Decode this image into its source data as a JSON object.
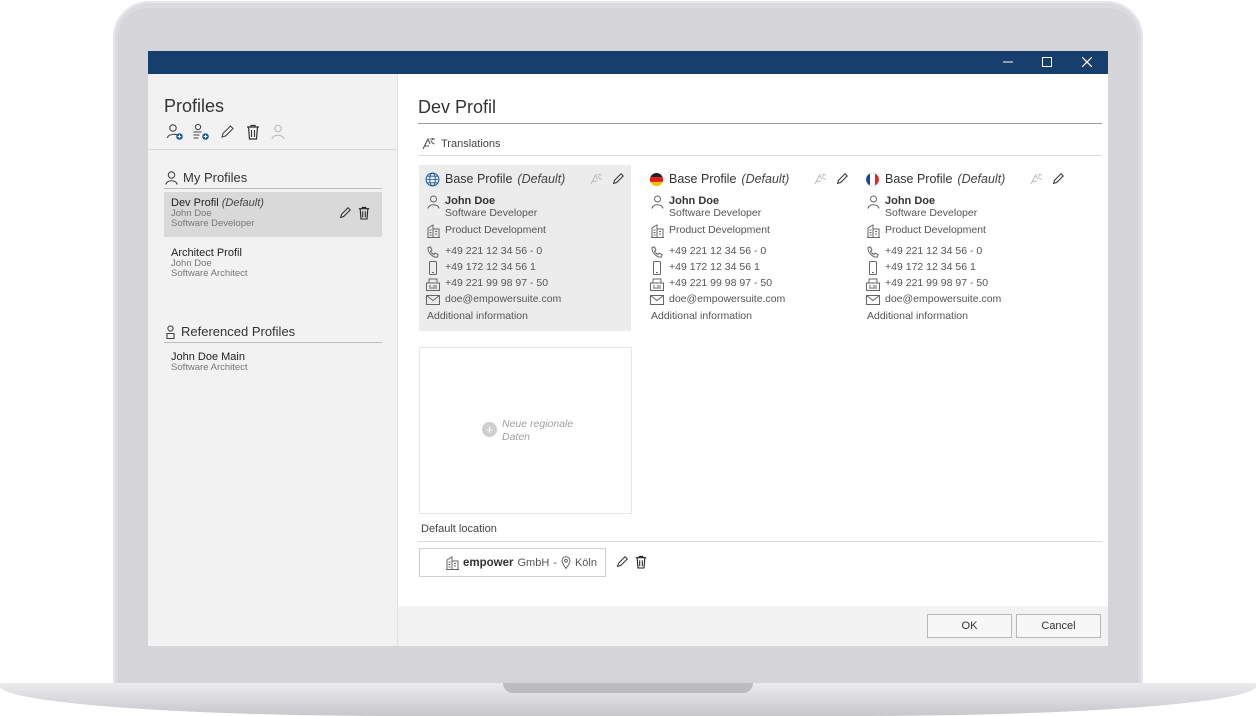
{
  "window": {
    "minimize_glyph": "—",
    "maximize_glyph": "☐",
    "close_glyph": "✕"
  },
  "left": {
    "title": "Profiles",
    "toolbar": [
      "add-user-icon",
      "add-group-icon",
      "pencil-icon",
      "trash-icon",
      "user-disabled-icon"
    ],
    "my_profiles_label": "My Profiles",
    "referenced_label": "Referenced Profiles",
    "profiles": [
      {
        "name": "Dev Profil",
        "default_tag": "(Default)",
        "person": "John Doe",
        "role": "Software Developer"
      },
      {
        "name": "Architect Profil",
        "default_tag": "",
        "person": "John Doe",
        "role": "Software Architect"
      }
    ],
    "referenced": [
      {
        "name": "John Doe Main",
        "role": "Software Architect"
      }
    ]
  },
  "main": {
    "title": "Dev Profil",
    "translations_label": "Translations",
    "cards": [
      {
        "flag": "globe",
        "title": "Base Profile",
        "default_tag": "(Default)",
        "name": "John Doe",
        "role": "Software Developer",
        "department": "Product Development",
        "phone": "+49 221 12 34 56 - 0",
        "mobile": "+49 172 12 34 56 1",
        "fax": "+49 221 99 98 97 - 50",
        "email": "doe@empowersuite.com",
        "additional": "Additional information"
      },
      {
        "flag": "de",
        "title": "Base Profile",
        "default_tag": "(Default)",
        "name": "John Doe",
        "role": "Software Developer",
        "department": "Product Development",
        "phone": "+49 221 12 34 56 - 0",
        "mobile": "+49 172 12 34 56 1",
        "fax": "+49 221 99 98 97 - 50",
        "email": "doe@empowersuite.com",
        "additional": "Additional information"
      },
      {
        "flag": "fr",
        "title": "Base Profile",
        "default_tag": "(Default)",
        "name": "John Doe",
        "role": "Software Developer",
        "department": "Product Development",
        "phone": "+49 221 12 34 56 - 0",
        "mobile": "+49 172 12 34 56 1",
        "fax": "+49 221 99 98 97 - 50",
        "email": "doe@empowersuite.com",
        "additional": "Additional information"
      }
    ],
    "new_region_label": "Neue regionale Daten",
    "default_location_label": "Default location",
    "location": {
      "company_bold": "empower",
      "company_rest": "GmbH",
      "separator": "-",
      "city": "Köln"
    }
  },
  "footer": {
    "ok_label": "OK",
    "cancel_label": "Cancel"
  },
  "colors": {
    "titlebar": "#163f6e",
    "selected_row": "#d9d9d9",
    "card_active": "#ececec"
  }
}
